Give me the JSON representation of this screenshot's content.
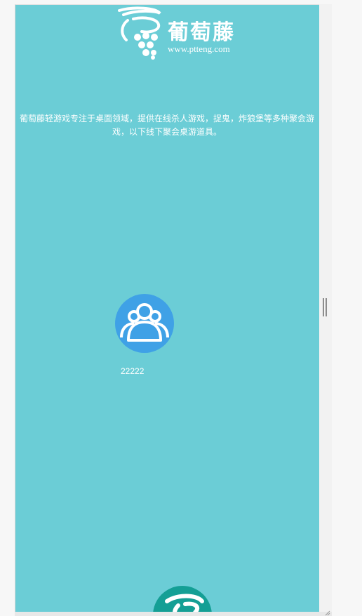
{
  "header": {
    "logo_title": "葡萄藤",
    "logo_url": "www.ptteng.com"
  },
  "intro": {
    "text": "葡萄藤轻游戏专注于桌面领域，提供在线杀人游戏，捉鬼，炸狼堡等多种聚会游戏，以下线下聚会桌游道具。"
  },
  "game": {
    "label": "22222",
    "icon": "group-users-icon",
    "icon_color": "#3fa1e6"
  },
  "colors": {
    "background": "#6bcdd6",
    "footer_logo": "#149f95"
  }
}
